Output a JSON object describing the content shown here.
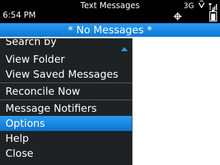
{
  "status": {
    "time": "6:54 PM",
    "app_title": "Text Messages",
    "network": "3G"
  },
  "title_bar": "* No Messages *",
  "menu": {
    "partial_item": "Search by",
    "items": [
      "View Folder",
      "View Saved Messages",
      "Reconcile Now",
      "Message Notifiers",
      "Options",
      "Help",
      "Close"
    ],
    "selected": "Options"
  },
  "colors": {
    "highlight": "#1a86e0",
    "menu_bg": "#1f2224",
    "content_bg": "#ffffff"
  }
}
